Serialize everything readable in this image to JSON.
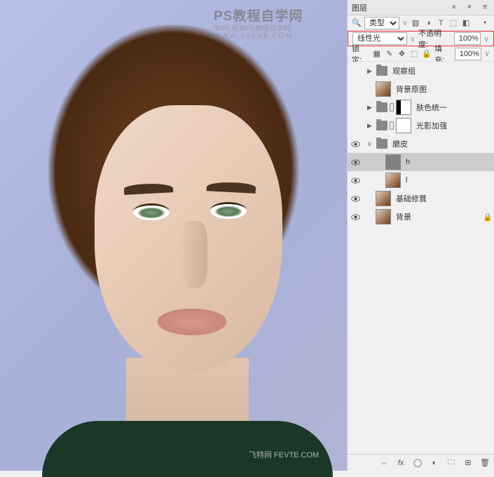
{
  "watermark": {
    "title": "PS教程自学网",
    "sub": "学PS,就到PS教程自学网",
    "url": "WWW.16XX8.COM",
    "bottom": "飞特网\nFEVTE.COM"
  },
  "panel": {
    "title": "图层",
    "filter_label": "类型",
    "blend_mode": "线性光",
    "opacity_label": "不透明度:",
    "opacity_value": "100%",
    "lock_label": "锁定:",
    "fill_label": "填充:",
    "fill_value": "100%"
  },
  "layers": {
    "g1": "观察组",
    "l1": "背景原图",
    "g2": "肤色统一",
    "g3": "光影加强",
    "g4": "磨皮",
    "l_h": "h",
    "l_l": "l",
    "l_base": "基础修葺",
    "l_bg": "背景"
  }
}
